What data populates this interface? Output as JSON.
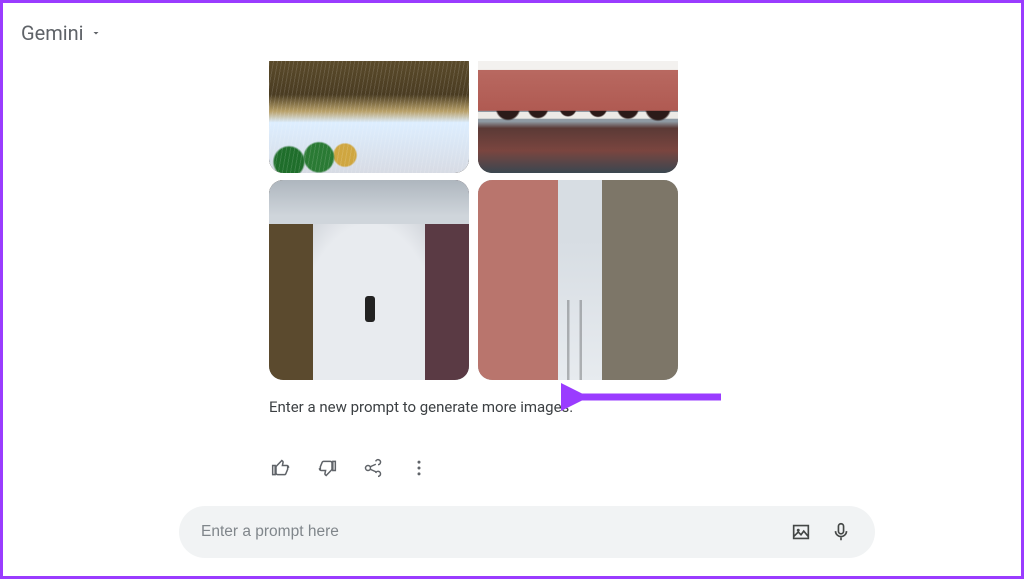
{
  "header": {
    "title": "Gemini"
  },
  "hint_text": "Enter a new prompt to generate more images.",
  "actions": {
    "like": "thumbs-up-icon",
    "dislike": "thumbs-down-icon",
    "share": "share-icon",
    "more": "more-options-icon"
  },
  "prompt": {
    "placeholder": "Enter a prompt here"
  },
  "icons": {
    "upload_image": "image-icon",
    "voice": "microphone-icon"
  }
}
